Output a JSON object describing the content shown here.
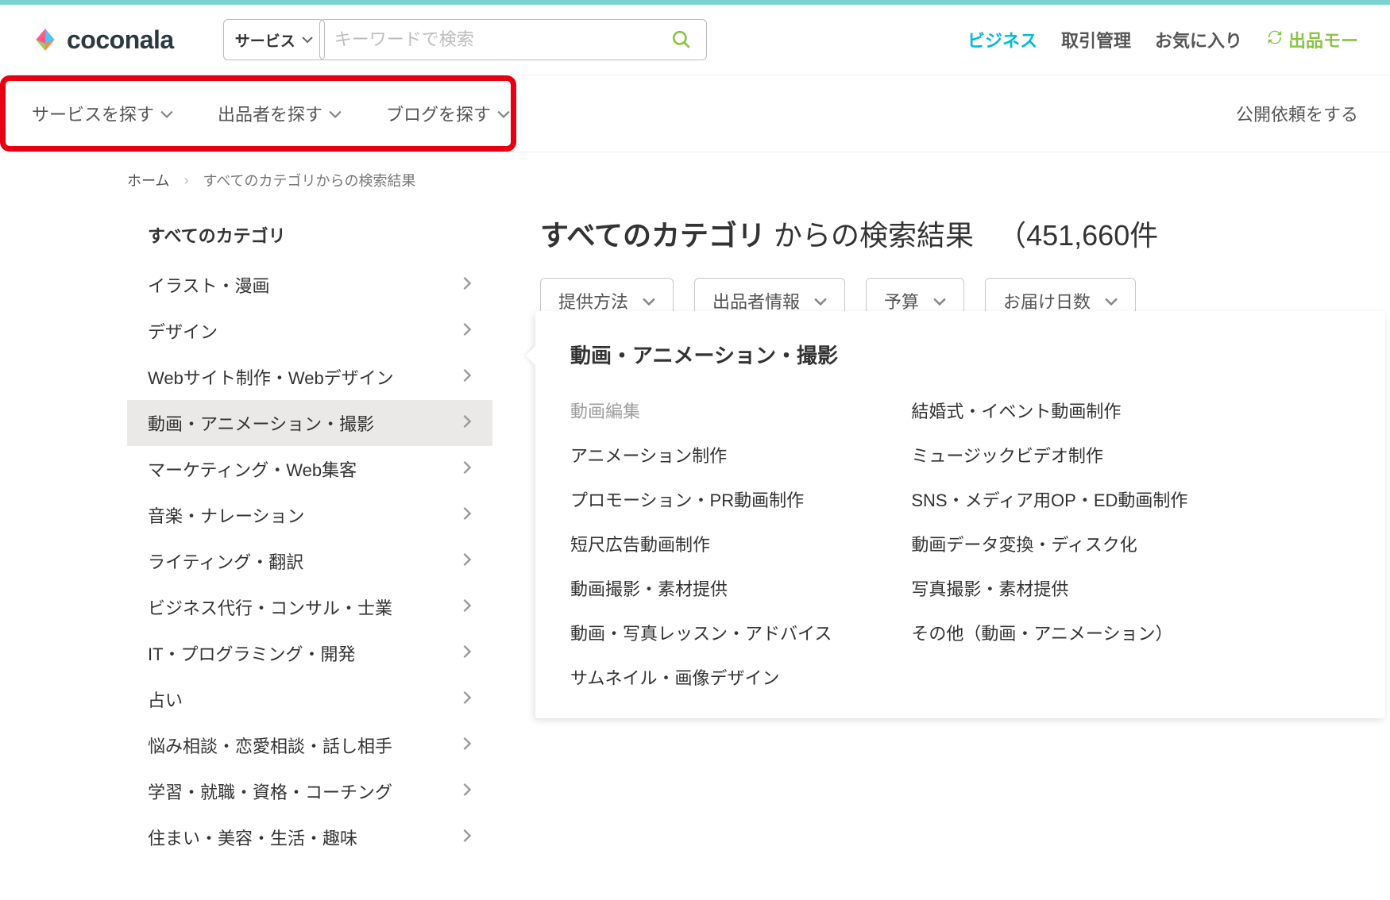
{
  "header": {
    "logo_text": "coconala",
    "search_selector": "サービス",
    "search_placeholder": "キーワードで検索",
    "links": {
      "business": "ビジネス",
      "transactions": "取引管理",
      "favorites": "お気に入り",
      "list_mode": "出品モー"
    }
  },
  "nav": {
    "items": [
      "サービスを探す",
      "出品者を探す",
      "ブログを探す"
    ],
    "right": "公開依頼をする"
  },
  "breadcrumb": {
    "home": "ホーム",
    "current": "すべてのカテゴリからの検索結果"
  },
  "sidebar": {
    "title": "すべてのカテゴリ",
    "items": [
      "イラスト・漫画",
      "デザイン",
      "Webサイト制作・Webデザイン",
      "動画・アニメーション・撮影",
      "マーケティング・Web集客",
      "音楽・ナレーション",
      "ライティング・翻訳",
      "ビジネス代行・コンサル・士業",
      "IT・プログラミング・開発",
      "占い",
      "悩み相談・恋愛相談・話し相手",
      "学習・就職・資格・コーチング",
      "住まい・美容・生活・趣味"
    ],
    "active_index": 3
  },
  "results": {
    "title_bold": "すべてのカテゴリ",
    "title_rest": " からの検索結果",
    "count_text": "（451,660件"
  },
  "filters": [
    "提供方法",
    "出品者情報",
    "予算",
    "お届け日数"
  ],
  "flyout": {
    "title": "動画・アニメーション・撮影",
    "left": [
      {
        "t": "動画編集",
        "muted": true
      },
      {
        "t": "アニメーション制作"
      },
      {
        "t": "プロモーション・PR動画制作"
      },
      {
        "t": "短尺広告動画制作"
      },
      {
        "t": "動画撮影・素材提供"
      },
      {
        "t": "動画・写真レッスン・アドバイス"
      },
      {
        "t": "サムネイル・画像デザイン"
      }
    ],
    "right": [
      {
        "t": "結婚式・イベント動画制作"
      },
      {
        "t": "ミュージックビデオ制作"
      },
      {
        "t": "SNS・メディア用OP・ED動画制作"
      },
      {
        "t": "動画データ変換・ディスク化"
      },
      {
        "t": "写真撮影・素材提供"
      },
      {
        "t": "その他（動画・アニメーション）"
      }
    ]
  }
}
